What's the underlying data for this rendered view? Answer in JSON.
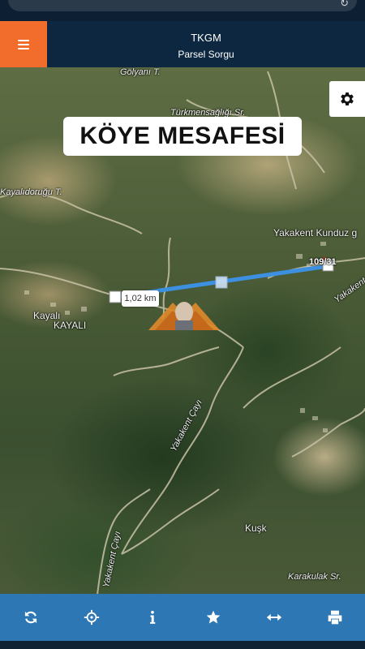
{
  "header": {
    "title": "TKGM",
    "subtitle": "Parsel Sorgu"
  },
  "icons": {
    "menu": "hamburger-icon",
    "settings": "gear-icon",
    "refresh": "refresh-icon",
    "locate": "crosshair-icon",
    "info": "info-icon",
    "favorite": "star-icon",
    "measure": "horizontal-arrows-icon",
    "print": "printer-icon"
  },
  "map": {
    "banner": "KÖYE MESAFESİ",
    "distance_label": "1,02 km",
    "parcel_label": "109/31",
    "place_labels": {
      "golyani": "Gölyanı T.",
      "turkmensagligi": "Türkmensağlığı Sr.",
      "kayalidorugu": "Kayalıdoruğu T.",
      "yakakent_kunduz": "Yakakent Kunduz g",
      "kayali": "Kayalı",
      "kayali_upper": "KAYALI",
      "yakakent_cayi": "Yakakent Çayı",
      "yakakent_cayi2": "Yakakent Çayı",
      "kusk": "Kuşk",
      "karakulak": "Karakulak Sr.",
      "yakakent_side": "Yakakent"
    },
    "measure_line_color": "#3d8fe0"
  },
  "colors": {
    "header_bg": "#0d2740",
    "menu_accent": "#f26d2b",
    "toolbar_bg": "#2c77b4"
  }
}
